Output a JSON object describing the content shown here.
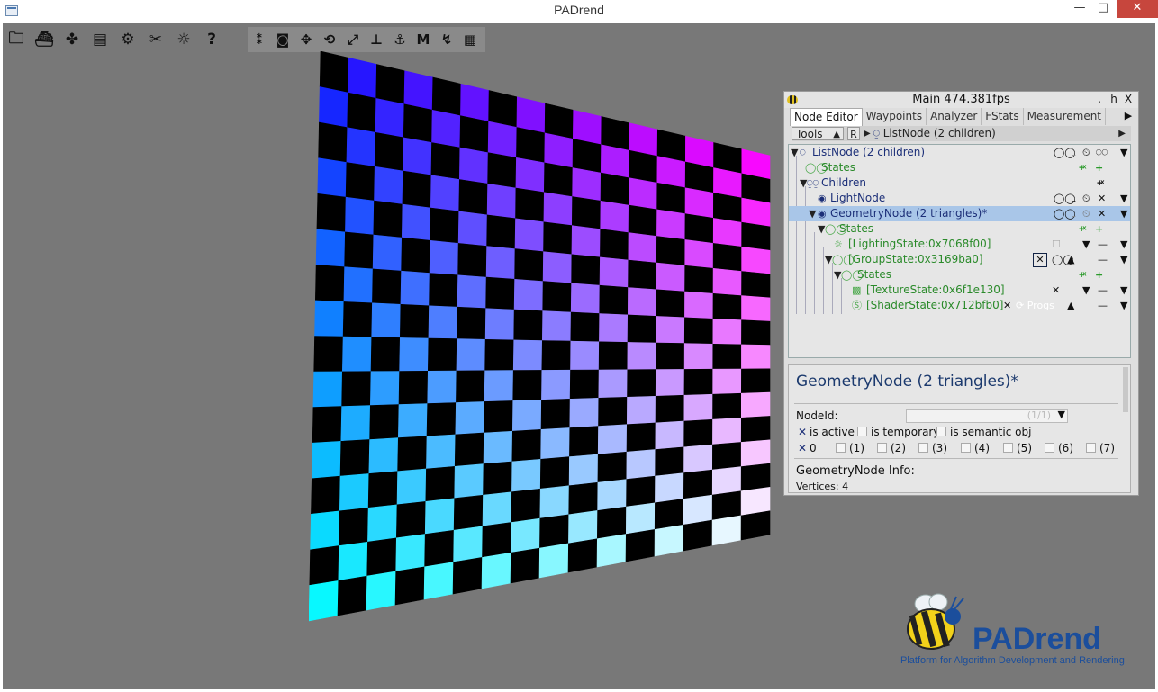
{
  "window": {
    "title": "PADrend",
    "minimize": "—",
    "maximize": "□",
    "close": "✕"
  },
  "toolbar": {
    "icons": [
      "folder-icon",
      "scene-icon",
      "plugin-icon",
      "config-icon",
      "gear-icon",
      "tools-icon",
      "effects-icon",
      "help-icon",
      "numpad-icon",
      "camera-icon",
      "move-icon",
      "rotate-icon",
      "scale-icon",
      "snap-icon",
      "anchor-icon",
      "measure-icon",
      "path-icon",
      "notes-icon"
    ],
    "glyphs": [
      "🗀",
      "⛴",
      "✤",
      "▤",
      "⚙",
      "✂",
      "☼",
      "?",
      "⁑",
      "◙",
      "✥",
      "⟲",
      "⤢",
      "⊥",
      "⚓",
      "Ⅿ",
      "↯",
      "▦"
    ]
  },
  "panel": {
    "title": "Main 474.381fps",
    "btn_dot": ".",
    "btn_h": "h",
    "btn_x": "X",
    "tabs": [
      "Node Editor",
      "Waypoints",
      "Analyzer",
      "FStats",
      "Measurement"
    ],
    "tools_label": "Tools",
    "r_label": "R",
    "breadcrumb": "ListNode (2 children)",
    "tree": [
      {
        "label": "ListNode (2 children)",
        "kind": "node"
      },
      {
        "label": "States",
        "kind": "states"
      },
      {
        "label": "Children",
        "kind": "node"
      },
      {
        "label": "LightNode",
        "kind": "node"
      },
      {
        "label": "GeometryNode (2 triangles)*",
        "kind": "node"
      },
      {
        "label": "States",
        "kind": "states"
      },
      {
        "label": "[LightingState:0x7068f00]",
        "kind": "state"
      },
      {
        "label": "[GroupState:0x3169ba0]",
        "kind": "state"
      },
      {
        "label": "States",
        "kind": "states"
      },
      {
        "label": "[TextureState:0x6f1e130]",
        "kind": "state"
      },
      {
        "label": "[ShaderState:0x712bfb0]",
        "kind": "state"
      }
    ],
    "progs_label": "Progs",
    "detail": {
      "title": "GeometryNode (2 triangles)*",
      "nodeid_label": "NodeId:",
      "nodeid_value": "(1/1)",
      "is_active": "is active",
      "is_temporary": "is temporary",
      "is_semantic": "is semantic obj",
      "layers": [
        "0",
        "(1)",
        "(2)",
        "(3)",
        "(4)",
        "(5)",
        "(6)",
        "(7)"
      ],
      "info_title": "GeometryNode Info:",
      "vertices": "Vertices: 4"
    }
  },
  "logo": {
    "name": "PADrend",
    "subtitle": "Platform for Algorithm Development and Rendering"
  },
  "colors": {
    "viewport_bg": "#787878",
    "checker_top_left": "#1010ff",
    "checker_top_right": "#ff00ff",
    "checker_bottom_left": "#00ffff",
    "checker_bottom_right": "#ffffff",
    "selection": "#a9c6e8",
    "tree_green": "#2a8a2a",
    "logo_blue": "#1b4e9c"
  }
}
